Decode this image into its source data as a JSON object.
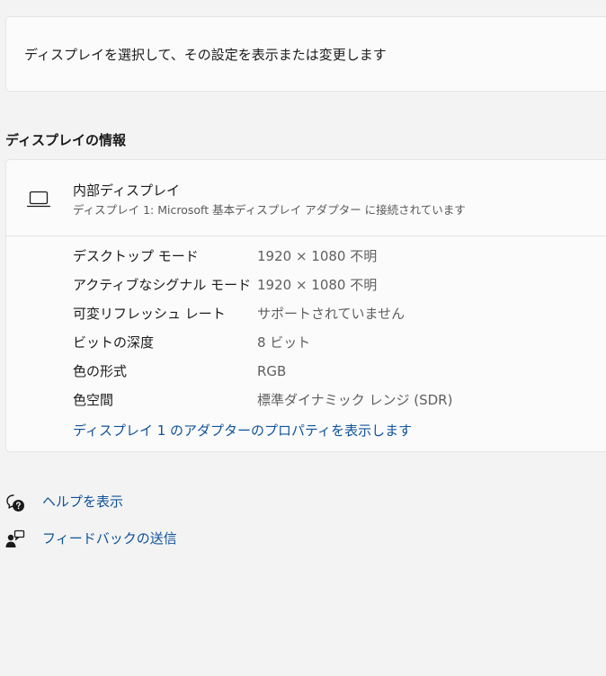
{
  "select_card": {
    "text": "ディスプレイを選択して、その設定を表示または変更します"
  },
  "section": {
    "title": "ディスプレイの情報"
  },
  "display": {
    "icon": "laptop-icon",
    "name": "内部ディスプレイ",
    "subtitle": "ディスプレイ 1: Microsoft 基本ディスプレイ アダプター に接続されています",
    "properties": [
      {
        "label": "デスクトップ モード",
        "value": "1920 × 1080 不明"
      },
      {
        "label": "アクティブなシグナル モード",
        "value": "1920 × 1080 不明"
      },
      {
        "label": "可変リフレッシュ レート",
        "value": "サポートされていません"
      },
      {
        "label": "ビットの深度",
        "value": "8 ビット"
      },
      {
        "label": "色の形式",
        "value": "RGB"
      },
      {
        "label": "色空間",
        "value": "標準ダイナミック レンジ (SDR)"
      }
    ],
    "adapter_link": "ディスプレイ 1 のアダプターのプロパティを表示します"
  },
  "links": {
    "help": {
      "icon": "help-icon",
      "label": "ヘルプを表示"
    },
    "feedback": {
      "icon": "feedback-icon",
      "label": "フィードバックの送信"
    }
  },
  "colors": {
    "background": "#f3f3f3",
    "card": "#fbfbfb",
    "link": "#0f5299",
    "secondary_text": "#5f5f5f"
  }
}
